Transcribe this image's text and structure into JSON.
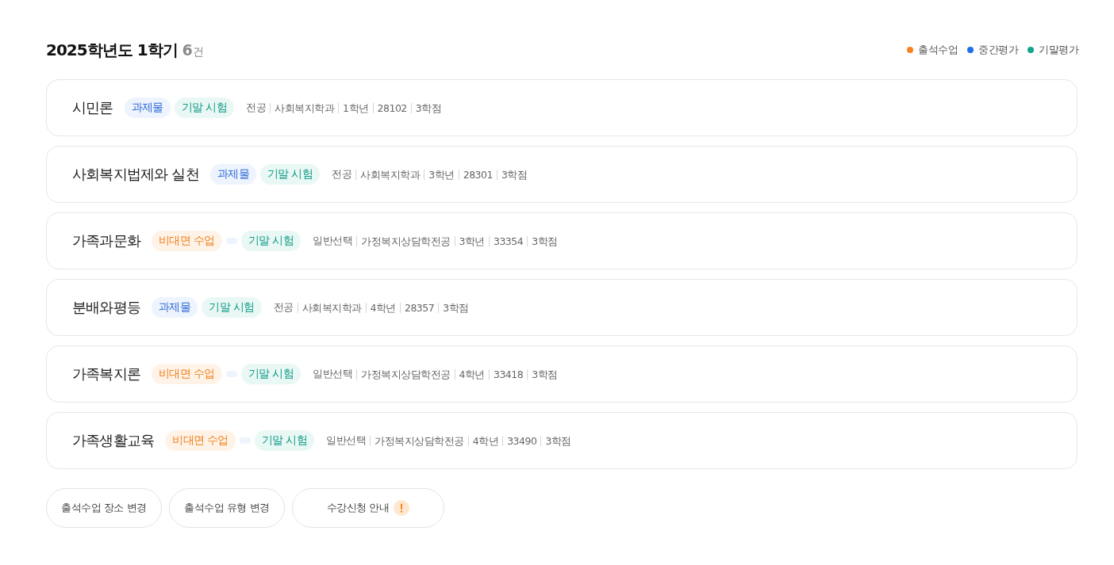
{
  "header": {
    "title": "2025학년도 1학기",
    "count": "6",
    "count_unit": "건"
  },
  "legend": [
    {
      "label": "출석수업",
      "color": "#f5841f"
    },
    {
      "label": "중간평가",
      "color": "#1f6fe5"
    },
    {
      "label": "기말평가",
      "color": "#14a38b"
    }
  ],
  "courses": [
    {
      "name": "시민론",
      "tags": [
        {
          "kind": "assignment",
          "label": "과제물"
        },
        {
          "kind": "final",
          "label": "기말 시험"
        }
      ],
      "meta": [
        "전공",
        "사회복지학과",
        "1학년",
        "28102",
        "3학점"
      ]
    },
    {
      "name": "사회복지법제와 실천",
      "tags": [
        {
          "kind": "assignment",
          "label": "과제물"
        },
        {
          "kind": "final",
          "label": "기말 시험"
        }
      ],
      "meta": [
        "전공",
        "사회복지학과",
        "3학년",
        "28301",
        "3학점"
      ]
    },
    {
      "name": "가족과문화",
      "tags": [
        {
          "kind": "remote",
          "label": "비대면 수업"
        },
        {
          "kind": "blank"
        },
        {
          "kind": "final",
          "label": "기말 시험"
        }
      ],
      "meta": [
        "일반선택",
        "가정복지상담학전공",
        "3학년",
        "33354",
        "3학점"
      ]
    },
    {
      "name": "분배와평등",
      "tags": [
        {
          "kind": "assignment",
          "label": "과제물"
        },
        {
          "kind": "final",
          "label": "기말 시험"
        }
      ],
      "meta": [
        "전공",
        "사회복지학과",
        "4학년",
        "28357",
        "3학점"
      ]
    },
    {
      "name": "가족복지론",
      "tags": [
        {
          "kind": "remote",
          "label": "비대면 수업"
        },
        {
          "kind": "blank"
        },
        {
          "kind": "final",
          "label": "기말 시험"
        }
      ],
      "meta": [
        "일반선택",
        "가정복지상담학전공",
        "4학년",
        "33418",
        "3학점"
      ]
    },
    {
      "name": "가족생활교육",
      "tags": [
        {
          "kind": "remote",
          "label": "비대면 수업"
        },
        {
          "kind": "blank"
        },
        {
          "kind": "final",
          "label": "기말 시험"
        }
      ],
      "meta": [
        "일반선택",
        "가정복지상담학전공",
        "4학년",
        "33490",
        "3학점"
      ]
    }
  ],
  "buttons": [
    {
      "label": "출석수업 장소 변경",
      "alert": false
    },
    {
      "label": "출석수업 유형 변경",
      "alert": false
    },
    {
      "label": "수강신청 안내",
      "alert": true
    }
  ]
}
